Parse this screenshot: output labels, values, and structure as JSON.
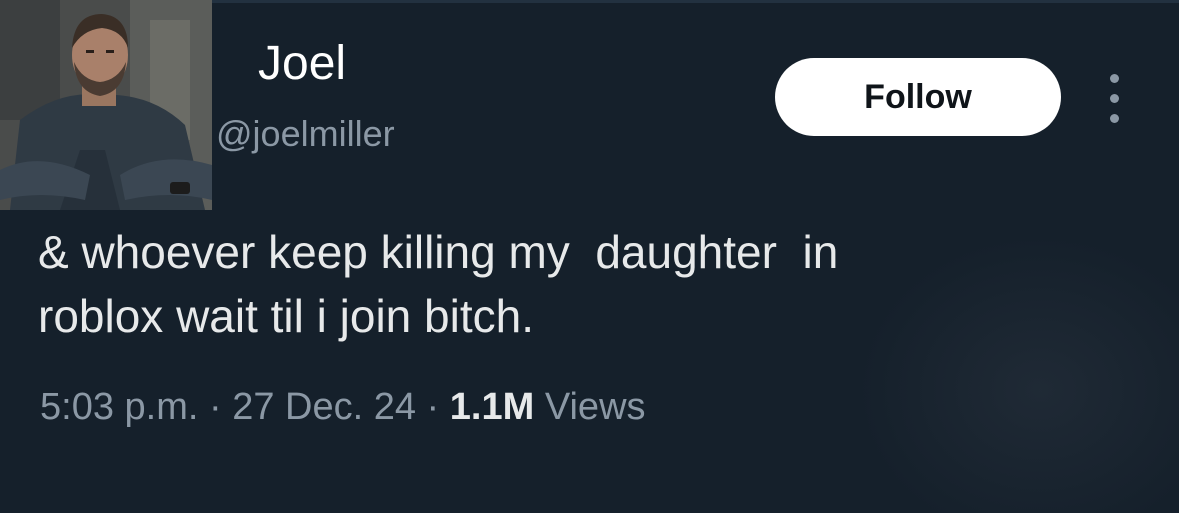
{
  "author": {
    "display_name": "Joel",
    "handle": "@joelmiller",
    "avatar_icon": "profile-photo-man-icon"
  },
  "actions": {
    "follow_label": "Follow",
    "more_icon": "vertical-ellipsis-icon"
  },
  "tweet": {
    "text_line1": "& whoever keep killing my  daughter  in",
    "text_line2": "roblox wait til i join bitch."
  },
  "meta": {
    "time": "5:03 p.m.",
    "separator": " · ",
    "date": "27 Dec. 24",
    "views_count": "1.1M",
    "views_label": "Views"
  },
  "colors": {
    "background": "#15202b",
    "primary_text": "#e7e9ea",
    "secondary_text": "#8b98a5",
    "follow_bg": "#ffffff",
    "follow_text": "#0f1419"
  }
}
